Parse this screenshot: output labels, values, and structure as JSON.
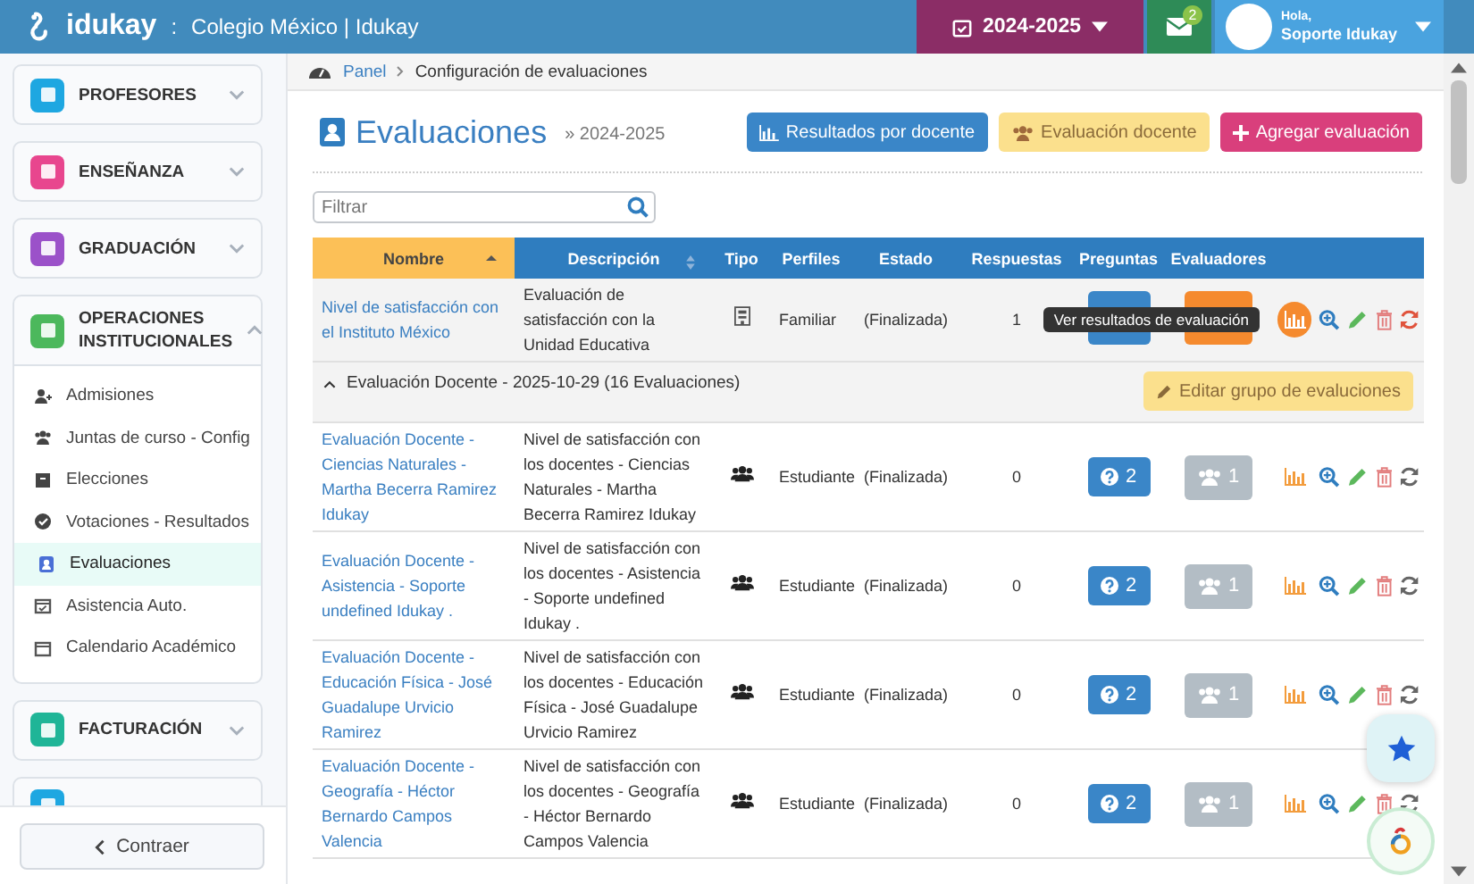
{
  "header": {
    "logo": "idukay",
    "separator": ":",
    "school": "Colegio México | Idukay",
    "year": "2024-2025",
    "mail_count": "2",
    "greeting": "Hola,",
    "user": "Soporte Idukay"
  },
  "sidebar": {
    "sections": [
      {
        "label": "PROFESORES",
        "color": "#1ea7e1",
        "expanded": false
      },
      {
        "label": "ENSEÑANZA",
        "color": "#e8468e",
        "expanded": false
      },
      {
        "label": "GRADUACIÓN",
        "color": "#9b51c9",
        "expanded": false
      },
      {
        "label": "OPERACIONES INSTITUCIONALES",
        "color": "#4cb85c",
        "expanded": true,
        "children": [
          {
            "label": "Admisiones",
            "kind": "user-plus",
            "selected": false
          },
          {
            "label": "Juntas de curso - Config",
            "kind": "users",
            "selected": false
          },
          {
            "label": "Elecciones",
            "kind": "box",
            "selected": false
          },
          {
            "label": "Votaciones - Resultados",
            "kind": "check",
            "selected": false
          },
          {
            "label": "Evaluaciones",
            "kind": "person",
            "selected": true
          },
          {
            "label": "Asistencia Auto.",
            "kind": "calendar-check",
            "selected": false
          },
          {
            "label": "Calendario Académico",
            "kind": "calendar",
            "selected": false
          }
        ]
      },
      {
        "label": "FACTURACIÓN",
        "color": "#1fb597",
        "expanded": false
      }
    ],
    "collapse": "Contraer"
  },
  "breadcrumb": [
    "Panel",
    "Configuración de evaluaciones"
  ],
  "title": "Evaluaciones",
  "subtitle": "» 2024-2025",
  "actions": [
    {
      "label": "Resultados por docente",
      "kind": "results"
    },
    {
      "label": "Evaluación docente",
      "kind": "teacher"
    },
    {
      "label": "Agregar evaluación",
      "kind": "add"
    }
  ],
  "filter": {
    "placeholder": "Filtrar"
  },
  "table": {
    "columns": [
      {
        "label": "Nombre",
        "selected": true,
        "sortable": true
      },
      {
        "label": "Descripción",
        "selected": false,
        "sortable": true
      },
      {
        "label": "Tipo",
        "selected": false,
        "sortable": false
      },
      {
        "label": "Perfiles",
        "selected": false,
        "sortable": false
      },
      {
        "label": "Estado",
        "selected": false,
        "sortable": false
      },
      {
        "label": "Respuestas",
        "selected": false,
        "sortable": false
      },
      {
        "label": "Preguntas",
        "selected": false,
        "sortable": false
      },
      {
        "label": "Evaluadores",
        "selected": false,
        "sortable": false
      }
    ],
    "rows": [
      {
        "kind": "institution",
        "name": "Nivel de satisfacción con el Instituto México",
        "description": "Evaluación de satisfacción con la Unidad Educativa",
        "profile": "Familiar",
        "status": "(Finalizada)",
        "responses": "1",
        "covered": true,
        "evaluators_active": true,
        "hovered": true,
        "tooltip": "Ver resultados de evaluación"
      }
    ],
    "groups": [
      {
        "label": "Evaluación Docente - 2025-10-29 (16 Evaluaciones)",
        "expanded": true,
        "button": "Editar grupo de evaluciones",
        "rows": [
          {
            "kind": "group",
            "name": "Evaluación Docente - Ciencias Naturales - Martha Becerra Ramirez Idukay",
            "description": "Nivel de satisfacción con los docentes - Ciencias Naturales - Martha Becerra Ramirez Idukay",
            "profile": "Estudiante",
            "status": "(Finalizada)",
            "responses": "0",
            "covered": false,
            "questions": "2",
            "evaluators": "1",
            "evaluators_active": false,
            "hovered": false
          },
          {
            "kind": "group",
            "name": "Evaluación Docente - Asistencia - Soporte undefined Idukay .",
            "description": "Nivel de satisfacción con los docentes - Asistencia - Soporte undefined Idukay .",
            "profile": "Estudiante",
            "status": "(Finalizada)",
            "responses": "0",
            "covered": false,
            "questions": "2",
            "evaluators": "1",
            "evaluators_active": false,
            "hovered": false
          },
          {
            "kind": "group",
            "name": "Evaluación Docente - Educación Física - José Guadalupe Urvicio Ramirez",
            "description": "Nivel de satisfacción con los docentes - Educación Física - José Guadalupe Urvicio Ramirez",
            "profile": "Estudiante",
            "status": "(Finalizada)",
            "responses": "0",
            "covered": false,
            "questions": "2",
            "evaluators": "1",
            "evaluators_active": false,
            "hovered": false
          },
          {
            "kind": "group",
            "name": "Evaluación Docente - Geografía - Héctor Bernardo Campos Valencia",
            "description": "Nivel de satisfacción con los docentes - Geografía - Héctor Bernardo Campos Valencia",
            "profile": "Estudiante",
            "status": "(Finalizada)",
            "responses": "0",
            "covered": false,
            "questions": "2",
            "evaluators": "1",
            "evaluators_active": false,
            "hovered": false
          }
        ]
      }
    ]
  }
}
